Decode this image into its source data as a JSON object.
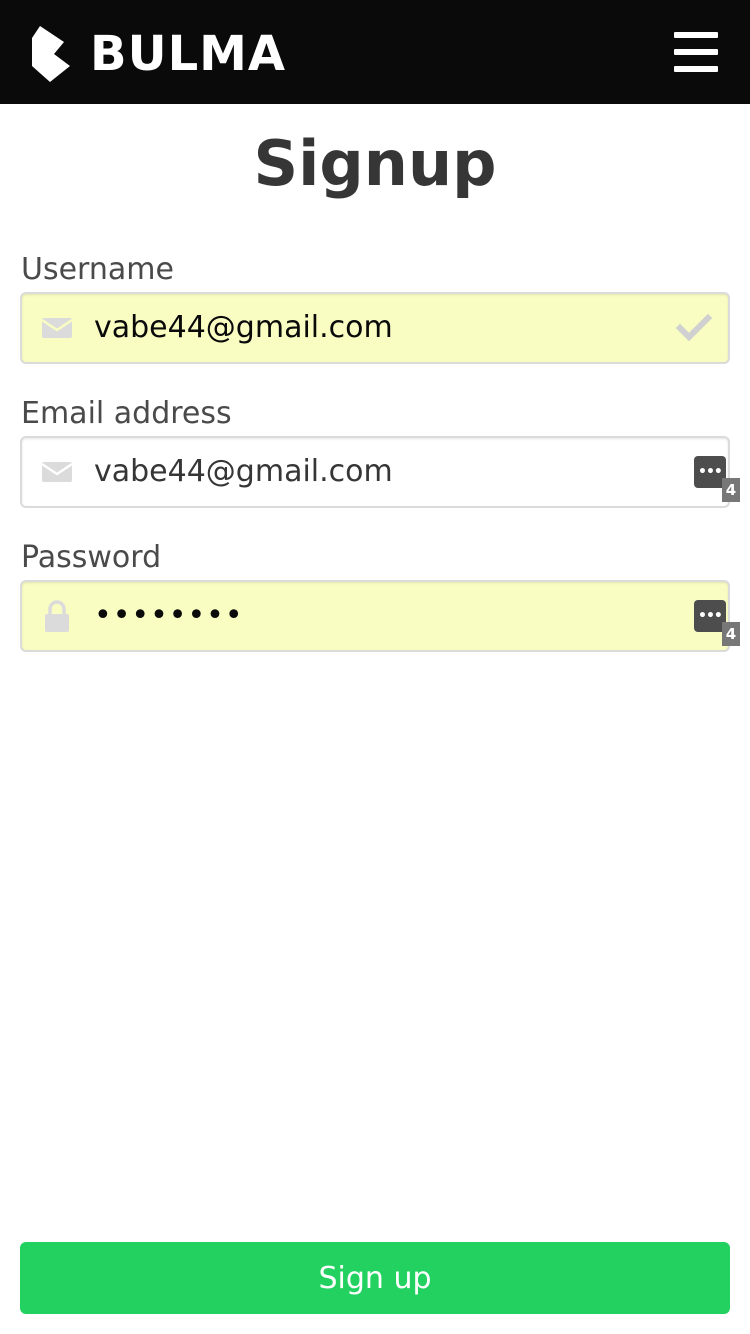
{
  "navbar": {
    "brand": "BULMA",
    "logo_icon": "bulma-logo-icon",
    "menu_icon": "hamburger-menu-icon"
  },
  "page": {
    "title": "Signup"
  },
  "form": {
    "username": {
      "label": "Username",
      "value": "vabe44@gmail.com",
      "left_icon": "envelope-icon",
      "right_icon": "checkmark-icon",
      "autofilled": true
    },
    "email": {
      "label": "Email address",
      "value": "vabe44@gmail.com",
      "left_icon": "envelope-icon",
      "right_icon": "password-manager-icon",
      "badge_count": "4",
      "autofilled": false
    },
    "password": {
      "label": "Password",
      "value": "••••••••",
      "left_icon": "lock-icon",
      "right_icon": "password-manager-icon",
      "badge_count": "4",
      "autofilled": true
    },
    "submit_label": "Sign up"
  },
  "colors": {
    "navbar_bg": "#0a0a0a",
    "autofill_bg": "#fafdc2",
    "submit_bg": "#23d160",
    "title_text": "#363636",
    "label_text": "#4a4a4a",
    "icon_gray": "#dbdbdb"
  }
}
